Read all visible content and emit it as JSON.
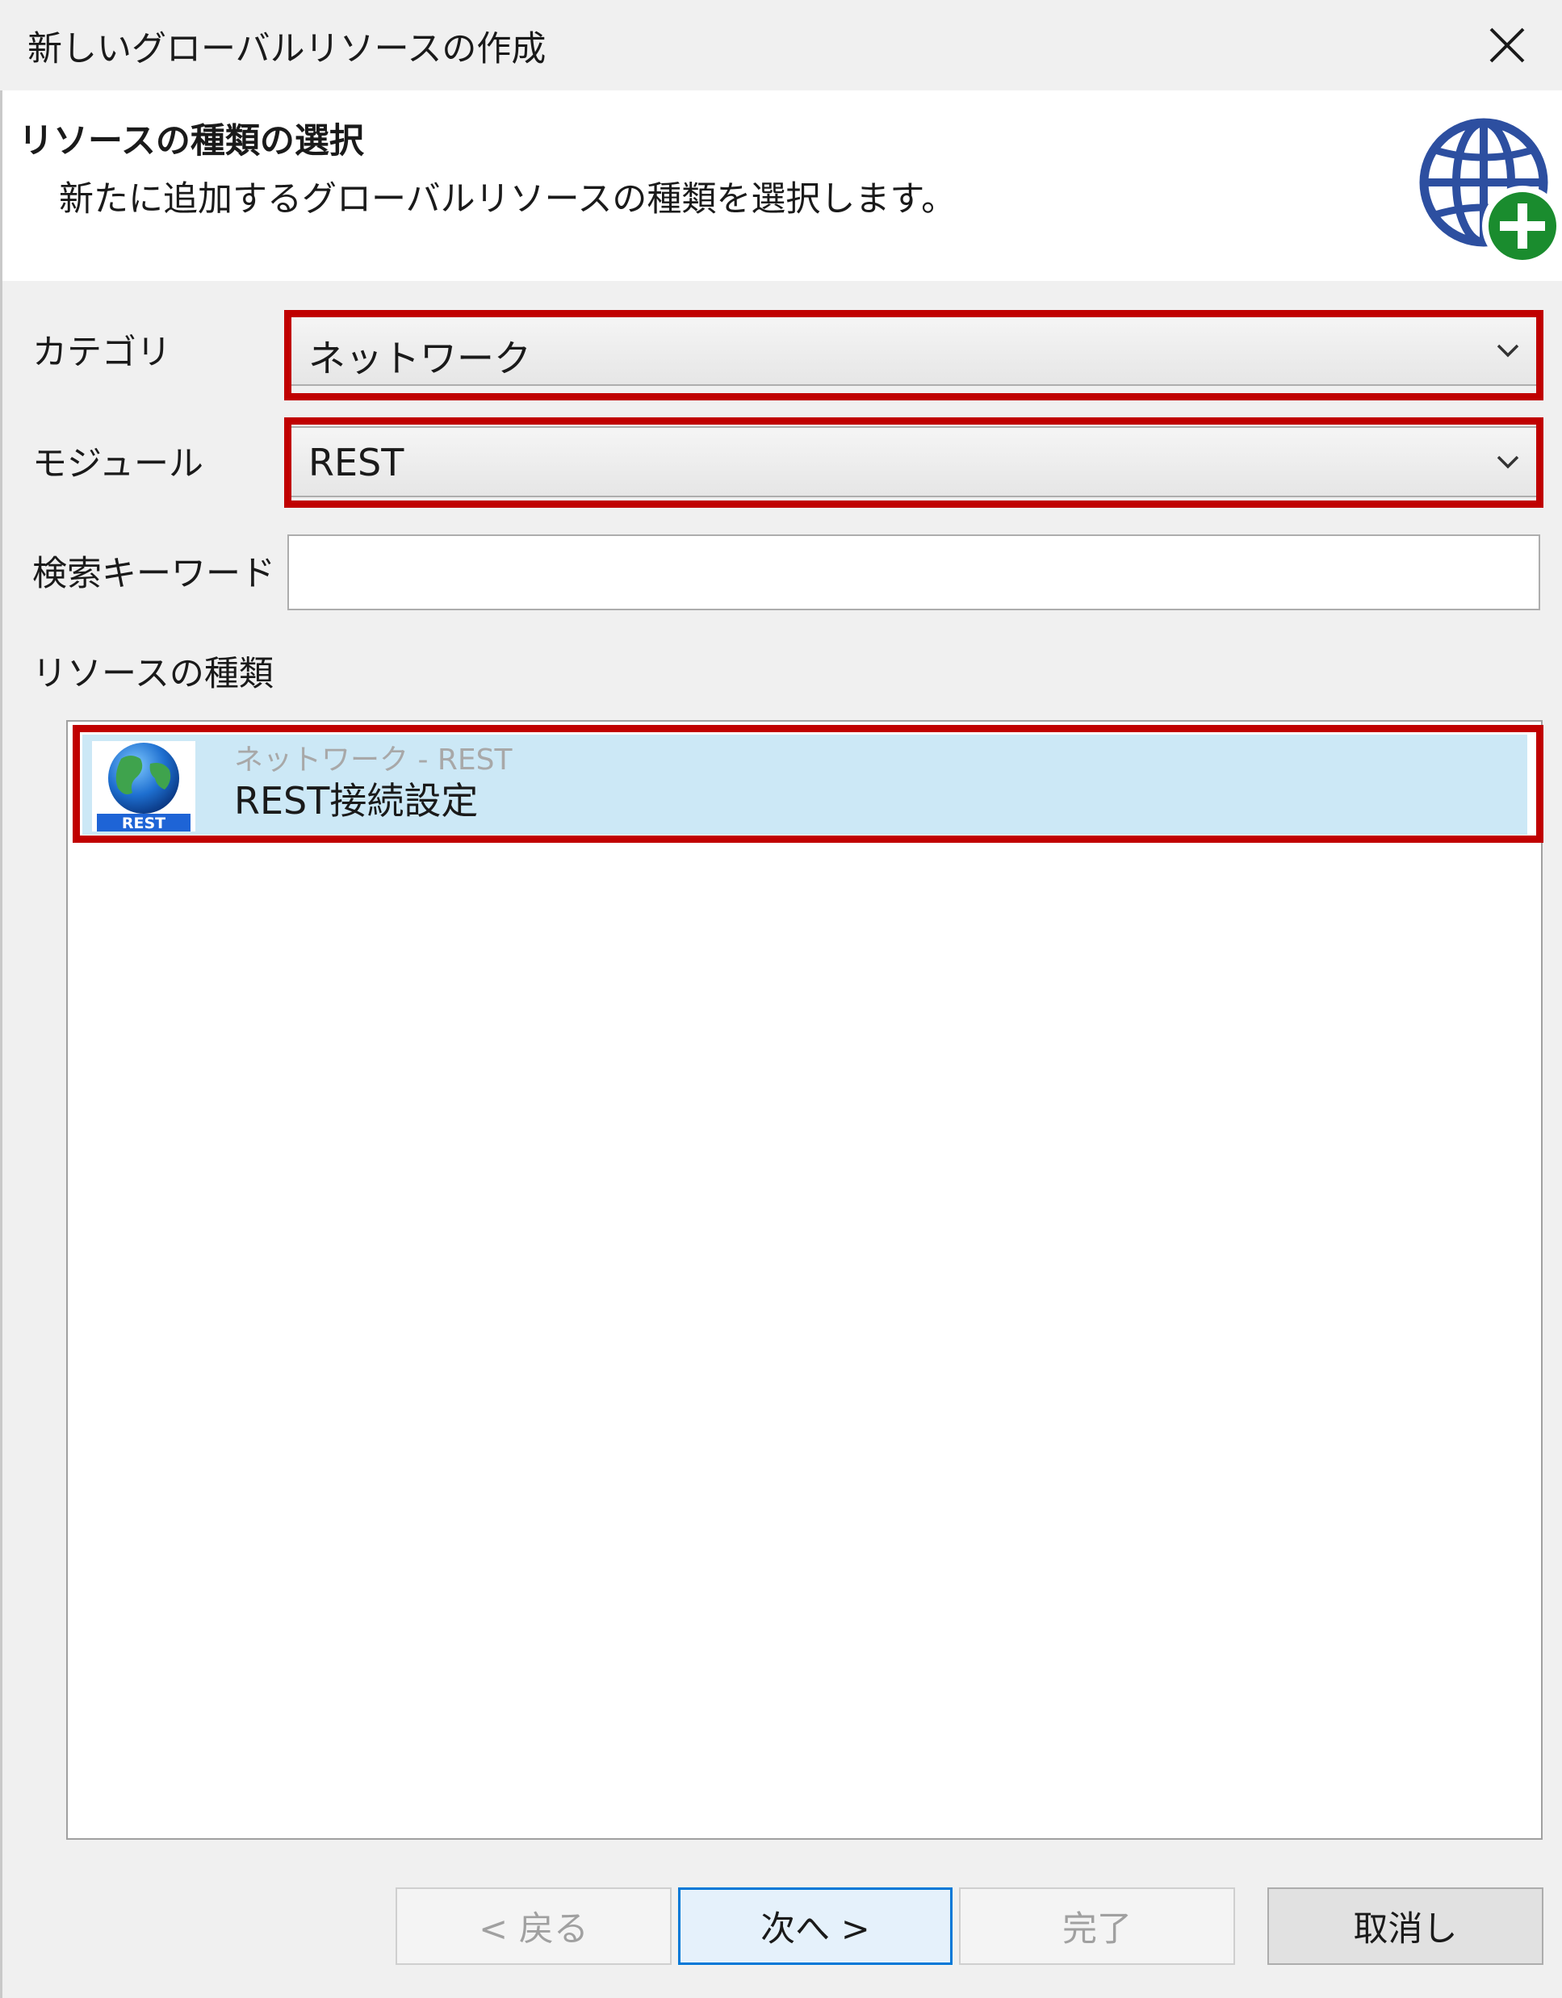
{
  "window": {
    "title": "新しいグローバルリソースの作成"
  },
  "header": {
    "title": "リソースの種類の選択",
    "description": "新たに追加するグローバルリソースの種類を選択します。"
  },
  "form": {
    "category_label": "カテゴリ",
    "category_value": "ネットワーク",
    "module_label": "モジュール",
    "module_value": "REST",
    "keyword_label": "検索キーワード",
    "keyword_value": ""
  },
  "resource_types": {
    "label": "リソースの種類",
    "items": [
      {
        "subtitle": "ネットワーク - REST",
        "name": "REST接続設定",
        "icon_text": "REST",
        "selected": true
      }
    ]
  },
  "buttons": {
    "back": "< 戻る",
    "next": "次へ >",
    "finish": "完了",
    "cancel": "取消し"
  },
  "colors": {
    "highlight": "#c00000",
    "selection": "#cce8f6",
    "default_button_border": "#0078d7",
    "add_badge": "#1a8c2e"
  }
}
